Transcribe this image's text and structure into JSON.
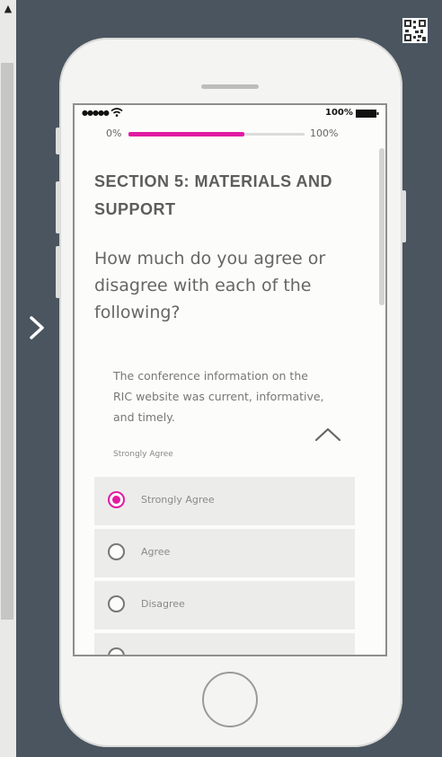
{
  "status_bar": {
    "signal": "●●●●●",
    "battery_percent": "100%"
  },
  "progress": {
    "min_label": "0%",
    "max_label": "100%",
    "fraction": 0.66,
    "fill_color": "#e11ba2"
  },
  "section": {
    "title": "SECTION 5:  MATERIALS AND SUPPORT"
  },
  "question": {
    "text": "How much do you agree or disagree with each of the following?",
    "statement": "The conference information on the RIC website was current, informative, and timely.",
    "selected_answer": "Strongly Agree",
    "options": [
      {
        "label": "Strongly Agree",
        "selected": true
      },
      {
        "label": "Agree",
        "selected": false
      },
      {
        "label": "Disagree",
        "selected": false
      },
      {
        "label": "",
        "selected": false
      }
    ]
  },
  "icons": {
    "nav": "chevron-right-icon",
    "qr": "qr-code-icon",
    "collapse": "chevron-up-icon",
    "wifi": "wifi-icon",
    "battery": "battery-icon"
  },
  "colors": {
    "accent": "#e11ba2",
    "background": "#4a5560"
  }
}
